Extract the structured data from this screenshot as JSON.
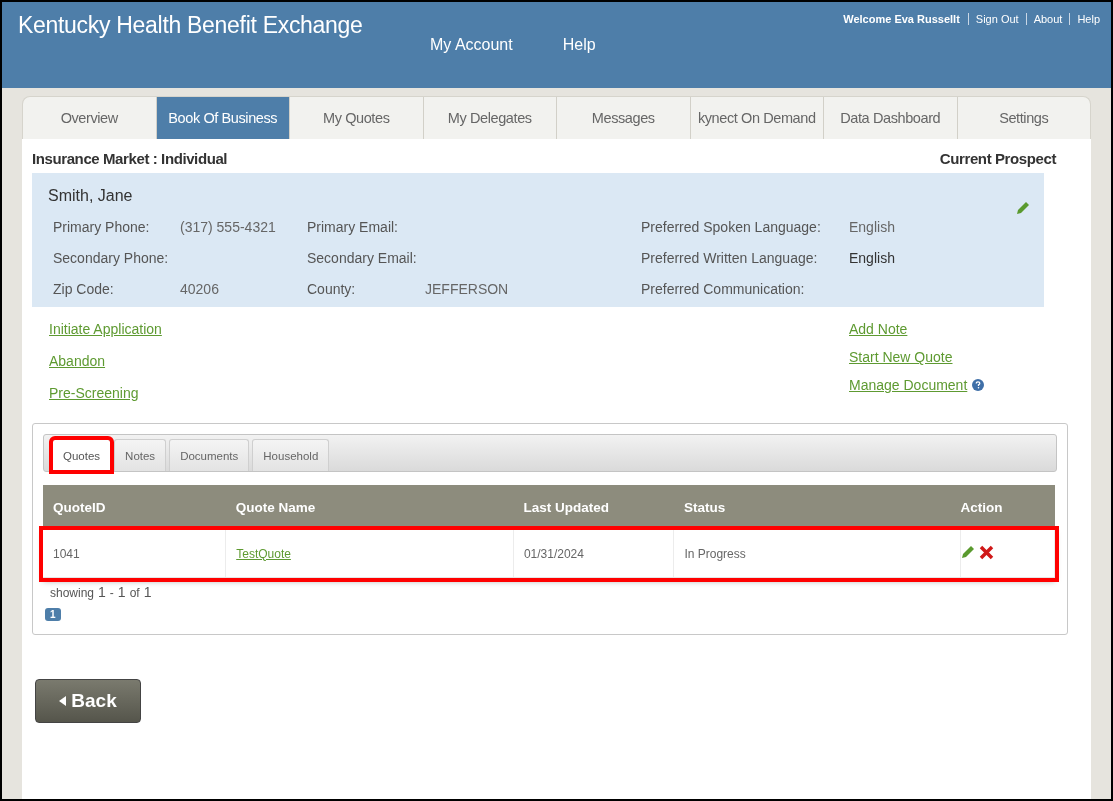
{
  "header": {
    "title": "Kentucky Health Benefit Exchange",
    "nav": [
      "My Account",
      "Help"
    ],
    "welcome": "Welcome Eva Russellt",
    "links": [
      "Sign Out",
      "About",
      "Help"
    ]
  },
  "tabs": [
    {
      "label": "Overview",
      "selected": false
    },
    {
      "label": "Book Of Business",
      "selected": true
    },
    {
      "label": "My Quotes",
      "selected": false
    },
    {
      "label": "My Delegates",
      "selected": false
    },
    {
      "label": "Messages",
      "selected": false
    },
    {
      "label": "kynect On Demand",
      "selected": false
    },
    {
      "label": "Data Dashboard",
      "selected": false
    },
    {
      "label": "Settings",
      "selected": false
    }
  ],
  "market": "Insurance Market : Individual",
  "prospect_heading": "Current Prospect",
  "prospect": {
    "name": "Smith, Jane",
    "rows": [
      [
        {
          "label": "Primary Phone:",
          "value": "(317) 555-4321"
        },
        {
          "label": "Primary Email:"
        },
        {
          "label": "Preferred Spoken Language:",
          "value": "English"
        }
      ],
      [
        {
          "label": "Secondary Phone:"
        },
        {
          "label": "Secondary Email:"
        },
        {
          "label": "Preferred Written Language:",
          "value": "English",
          "strong": true
        }
      ],
      [
        {
          "label": "Zip Code:",
          "value": "40206"
        },
        {
          "label": "County:",
          "value": "JEFFERSON"
        },
        {
          "label": "Preferred Communication:"
        }
      ]
    ]
  },
  "left_links": [
    {
      "label": "Initiate Application"
    },
    {
      "label": "Abandon"
    },
    {
      "label": "Pre-Screening"
    }
  ],
  "right_links": [
    {
      "label": "Add Note"
    },
    {
      "label": "Start New Quote"
    },
    {
      "label": "Manage Document",
      "help": true
    }
  ],
  "subtabs": [
    {
      "label": "Quotes",
      "selected": true,
      "highlighted": true
    },
    {
      "label": "Notes",
      "selected": false,
      "highlighted": false
    },
    {
      "label": "Documents",
      "selected": false,
      "highlighted": false
    },
    {
      "label": "Household",
      "selected": false,
      "highlighted": false
    }
  ],
  "table": {
    "columns": [
      "QuoteID",
      "Quote Name",
      "Last Updated",
      "Status",
      "Action"
    ],
    "rows": [
      {
        "cells": [
          "1041",
          "TestQuote",
          "01/31/2024",
          "In Progress"
        ],
        "highlighted": true
      }
    ]
  },
  "pager": {
    "showing": "showing",
    "from": "1",
    "dash": "-",
    "to": "1",
    "of": "of",
    "total": "1",
    "pages": [
      {
        "label": "1",
        "selected": true
      }
    ]
  },
  "back_button": "Back"
}
